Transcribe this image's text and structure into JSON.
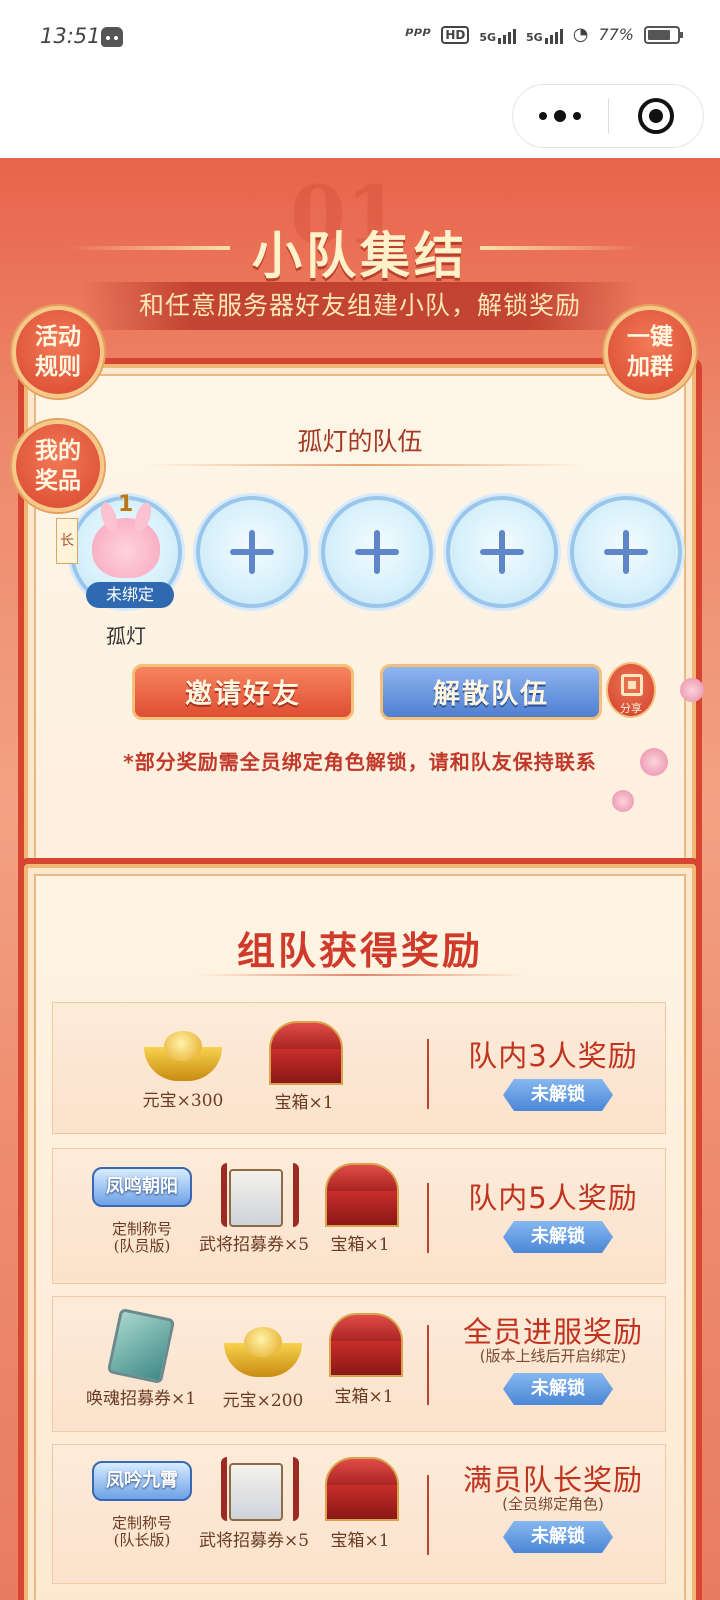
{
  "status_bar": {
    "time": "13:51",
    "network": "5G",
    "network2": "5G",
    "battery": "77%"
  },
  "capsule": {
    "more_icon": "more-dots-icon",
    "close_icon": "close-target-icon"
  },
  "header": {
    "big_number": "01",
    "title": "小队集结",
    "subtitle": "和任意服务器好友组建小队，解锁奖励"
  },
  "side_buttons": {
    "rules": "活动\n规则",
    "my_prizes": "我的\n奖品",
    "join_group": "一键\n加群"
  },
  "team": {
    "name": "孤灯的队伍",
    "leader_badge": "长",
    "leader_rank": "1",
    "unbound_tag": "未绑定",
    "leader_name": "孤灯",
    "empty_slots": 4,
    "invite_label": "邀请好友",
    "disband_label": "解散队伍",
    "share_label": "分享",
    "note": "*部分奖励需全员绑定角色解锁，请和队友保持联系"
  },
  "rewards": {
    "title": "组队获得奖励",
    "tiers": [
      {
        "title": "队内3人奖励",
        "subtitle": "",
        "button": "未解锁",
        "items": [
          {
            "icon": "ingot-icon",
            "label": "元宝×300"
          },
          {
            "icon": "chest-icon",
            "label": "宝箱×1"
          }
        ]
      },
      {
        "title": "队内5人奖励",
        "subtitle": "",
        "button": "未解锁",
        "items": [
          {
            "icon": "title-badge-icon",
            "badge_text": "凤鸣朝阳",
            "label": "定制称号\n(队员版)"
          },
          {
            "icon": "scroll-icon",
            "label": "武将招募券×5"
          },
          {
            "icon": "chest-icon",
            "label": "宝箱×1"
          }
        ]
      },
      {
        "title": "全员进服奖励",
        "subtitle": "(版本上线后开启绑定)",
        "button": "未解锁",
        "items": [
          {
            "icon": "ticket-icon",
            "label": "唤魂招募券×1"
          },
          {
            "icon": "ingot-icon",
            "label": "元宝×200"
          },
          {
            "icon": "chest-icon",
            "label": "宝箱×1"
          }
        ]
      },
      {
        "title": "满员队长奖励",
        "subtitle": "(全员绑定角色)",
        "button": "未解锁",
        "items": [
          {
            "icon": "title-badge-icon",
            "badge_text": "凤吟九霄",
            "label": "定制称号\n(队长版)"
          },
          {
            "icon": "scroll-icon",
            "label": "武将招募券×5"
          },
          {
            "icon": "chest-icon",
            "label": "宝箱×1"
          }
        ]
      }
    ]
  },
  "colors": {
    "accent_red": "#d03a2a",
    "unlock_blue": "#4b86d6",
    "cream": "#fff6e8"
  }
}
